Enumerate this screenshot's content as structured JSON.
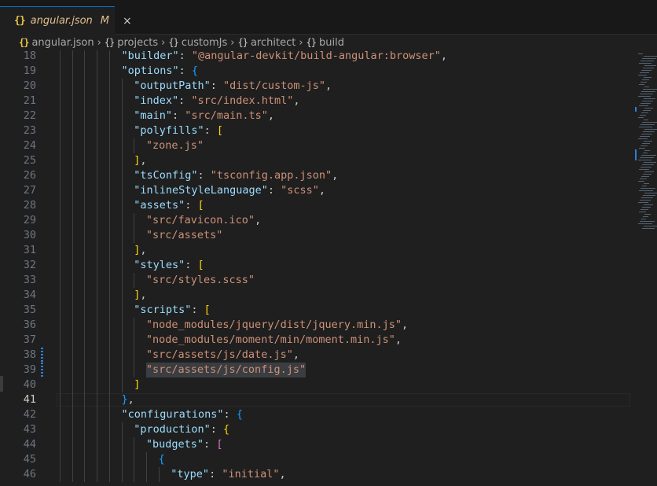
{
  "tab": {
    "icon": "json-braces-icon",
    "name": "angular.json",
    "modified": "M",
    "close": "×"
  },
  "breadcrumb": [
    "angular.json",
    "projects",
    "customJs",
    "architect",
    "build"
  ],
  "editor": {
    "active_line": 41,
    "lines": [
      {
        "n": "18",
        "indent": 5,
        "tokens": [
          [
            "k",
            "\"builder\""
          ],
          [
            "p",
            ": "
          ],
          [
            "s",
            "\"@angular-devkit/build-angular:browser\""
          ],
          [
            "p",
            ","
          ]
        ]
      },
      {
        "n": "19",
        "indent": 5,
        "tokens": [
          [
            "k",
            "\"options\""
          ],
          [
            "p",
            ": "
          ],
          [
            "b3",
            "{"
          ]
        ]
      },
      {
        "n": "20",
        "indent": 6,
        "tokens": [
          [
            "k",
            "\"outputPath\""
          ],
          [
            "p",
            ": "
          ],
          [
            "s",
            "\"dist/custom-js\""
          ],
          [
            "p",
            ","
          ]
        ]
      },
      {
        "n": "21",
        "indent": 6,
        "tokens": [
          [
            "k",
            "\"index\""
          ],
          [
            "p",
            ": "
          ],
          [
            "s",
            "\"src/index.html\""
          ],
          [
            "p",
            ","
          ]
        ]
      },
      {
        "n": "22",
        "indent": 6,
        "tokens": [
          [
            "k",
            "\"main\""
          ],
          [
            "p",
            ": "
          ],
          [
            "s",
            "\"src/main.ts\""
          ],
          [
            "p",
            ","
          ]
        ]
      },
      {
        "n": "23",
        "indent": 6,
        "tokens": [
          [
            "k",
            "\"polyfills\""
          ],
          [
            "p",
            ": "
          ],
          [
            "b1",
            "["
          ]
        ]
      },
      {
        "n": "24",
        "indent": 7,
        "tokens": [
          [
            "s",
            "\"zone.js\""
          ]
        ]
      },
      {
        "n": "25",
        "indent": 6,
        "tokens": [
          [
            "b1",
            "]"
          ],
          [
            "p",
            ","
          ]
        ]
      },
      {
        "n": "26",
        "indent": 6,
        "tokens": [
          [
            "k",
            "\"tsConfig\""
          ],
          [
            "p",
            ": "
          ],
          [
            "s",
            "\"tsconfig.app.json\""
          ],
          [
            "p",
            ","
          ]
        ]
      },
      {
        "n": "27",
        "indent": 6,
        "tokens": [
          [
            "k",
            "\"inlineStyleLanguage\""
          ],
          [
            "p",
            ": "
          ],
          [
            "s",
            "\"scss\""
          ],
          [
            "p",
            ","
          ]
        ]
      },
      {
        "n": "28",
        "indent": 6,
        "tokens": [
          [
            "k",
            "\"assets\""
          ],
          [
            "p",
            ": "
          ],
          [
            "b1",
            "["
          ]
        ]
      },
      {
        "n": "29",
        "indent": 7,
        "tokens": [
          [
            "s",
            "\"src/favicon.ico\""
          ],
          [
            "p",
            ","
          ]
        ]
      },
      {
        "n": "30",
        "indent": 7,
        "tokens": [
          [
            "s",
            "\"src/assets\""
          ]
        ]
      },
      {
        "n": "31",
        "indent": 6,
        "tokens": [
          [
            "b1",
            "]"
          ],
          [
            "p",
            ","
          ]
        ]
      },
      {
        "n": "32",
        "indent": 6,
        "tokens": [
          [
            "k",
            "\"styles\""
          ],
          [
            "p",
            ": "
          ],
          [
            "b1",
            "["
          ]
        ]
      },
      {
        "n": "33",
        "indent": 7,
        "tokens": [
          [
            "s",
            "\"src/styles.scss\""
          ]
        ]
      },
      {
        "n": "34",
        "indent": 6,
        "tokens": [
          [
            "b1",
            "]"
          ],
          [
            "p",
            ","
          ]
        ]
      },
      {
        "n": "35",
        "indent": 6,
        "tokens": [
          [
            "k",
            "\"scripts\""
          ],
          [
            "p",
            ": "
          ],
          [
            "b1",
            "["
          ]
        ]
      },
      {
        "n": "36",
        "indent": 7,
        "tokens": [
          [
            "s",
            "\"node_modules/jquery/dist/jquery.min.js\""
          ],
          [
            "p",
            ","
          ]
        ]
      },
      {
        "n": "37",
        "indent": 7,
        "tokens": [
          [
            "s",
            "\"node_modules/moment/min/moment.min.js\""
          ],
          [
            "p",
            ","
          ]
        ]
      },
      {
        "n": "38",
        "indent": 7,
        "tokens": [
          [
            "s",
            "\"src/assets/js/date.js\""
          ],
          [
            "p",
            ","
          ]
        ]
      },
      {
        "n": "39",
        "indent": 7,
        "tokens": [
          [
            "s",
            "\"src/assets/js/config.js\""
          ]
        ]
      },
      {
        "n": "40",
        "indent": 6,
        "tokens": [
          [
            "b1",
            "]"
          ]
        ]
      },
      {
        "n": "41",
        "indent": 5,
        "tokens": [
          [
            "b3",
            "}"
          ],
          [
            "p",
            ","
          ]
        ]
      },
      {
        "n": "42",
        "indent": 5,
        "tokens": [
          [
            "k",
            "\"configurations\""
          ],
          [
            "p",
            ": "
          ],
          [
            "b3",
            "{"
          ]
        ]
      },
      {
        "n": "43",
        "indent": 6,
        "tokens": [
          [
            "k",
            "\"production\""
          ],
          [
            "p",
            ": "
          ],
          [
            "b1",
            "{"
          ]
        ]
      },
      {
        "n": "44",
        "indent": 7,
        "tokens": [
          [
            "k",
            "\"budgets\""
          ],
          [
            "p",
            ": "
          ],
          [
            "b2",
            "["
          ]
        ]
      },
      {
        "n": "45",
        "indent": 8,
        "tokens": [
          [
            "b3",
            "{"
          ]
        ]
      },
      {
        "n": "46",
        "indent": 9,
        "tokens": [
          [
            "k",
            "\"type\""
          ],
          [
            "p",
            ": "
          ],
          [
            "s",
            "\"initial\""
          ],
          [
            "p",
            ","
          ]
        ]
      }
    ],
    "selected_line": "39",
    "modified_lines": [
      "38",
      "39"
    ]
  },
  "colors": {
    "accent": "#0078d4",
    "key": "#9cdcfe",
    "string": "#ce9178",
    "bracket_gold": "#ffd700",
    "bracket_blue": "#179fff",
    "bracket_pink": "#da70d6"
  }
}
